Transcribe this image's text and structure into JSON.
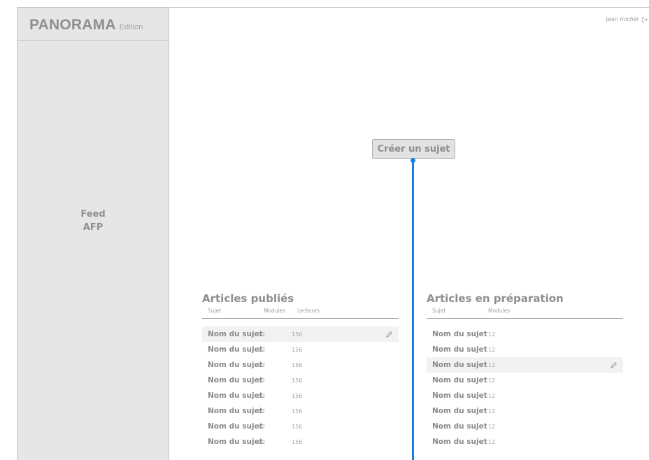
{
  "brand": {
    "name": "PANORAMA",
    "edition": "Edition"
  },
  "sidebar": {
    "feed_line1": "Feed",
    "feed_line2": "AFP"
  },
  "user": {
    "name": "Jean michel",
    "logout_icon": "logout-icon"
  },
  "main": {
    "create_button": "Créer un sujet"
  },
  "published": {
    "title": "Articles publiés",
    "columns": [
      "Sujet",
      "Modules",
      "Lecteurs"
    ],
    "rows": [
      {
        "name": "Nom du sujet",
        "modules": "12",
        "lecteurs": "156"
      },
      {
        "name": "Nom du sujet",
        "modules": "12",
        "lecteurs": "156"
      },
      {
        "name": "Nom du sujet",
        "modules": "12",
        "lecteurs": "156"
      },
      {
        "name": "Nom du sujet",
        "modules": "12",
        "lecteurs": "156"
      },
      {
        "name": "Nom du sujet",
        "modules": "12",
        "lecteurs": "156"
      },
      {
        "name": "Nom du sujet",
        "modules": "12",
        "lecteurs": "156"
      },
      {
        "name": "Nom du sujet",
        "modules": "12",
        "lecteurs": "156"
      },
      {
        "name": "Nom du sujet",
        "modules": "12",
        "lecteurs": "156"
      }
    ]
  },
  "preparation": {
    "title": "Articles en préparation",
    "columns": [
      "Sujet",
      "Modules"
    ],
    "rows": [
      {
        "name": "Nom du sujet",
        "modules": "12"
      },
      {
        "name": "Nom du sujet",
        "modules": "12"
      },
      {
        "name": "Nom du sujet",
        "modules": "12"
      },
      {
        "name": "Nom du sujet",
        "modules": "12"
      },
      {
        "name": "Nom du sujet",
        "modules": "12"
      },
      {
        "name": "Nom du sujet",
        "modules": "12"
      },
      {
        "name": "Nom du sujet",
        "modules": "12"
      },
      {
        "name": "Nom du sujet",
        "modules": "12"
      }
    ]
  },
  "colors": {
    "accent": "#1a7fe0",
    "panel": "#e6e6e6"
  }
}
